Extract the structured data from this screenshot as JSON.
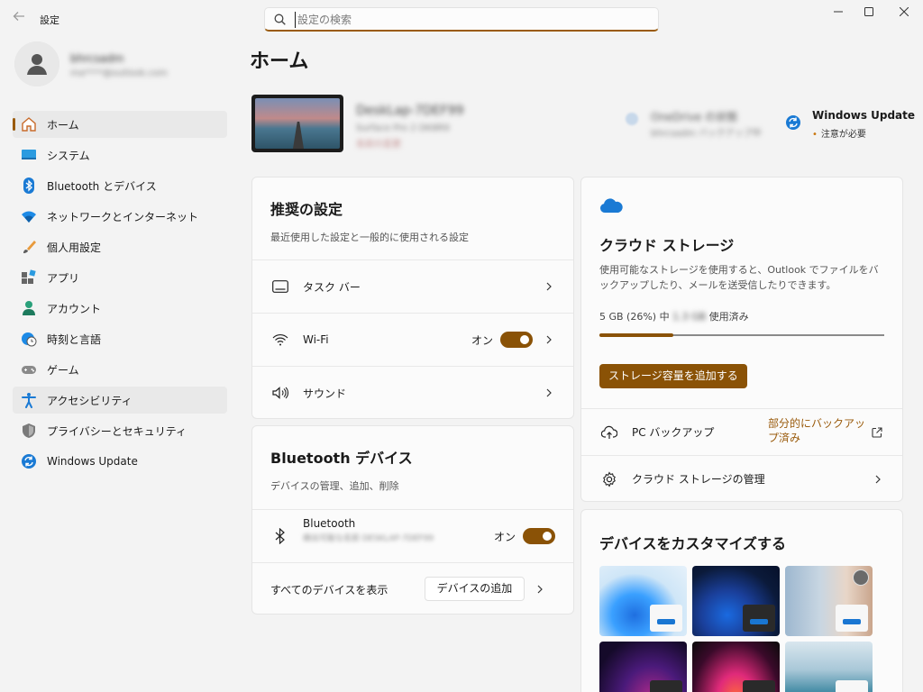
{
  "window": {
    "app_title": "設定",
    "controls": {
      "minimize": "—",
      "maximize": "☐",
      "close": "✕"
    }
  },
  "search": {
    "placeholder": "設定の検索",
    "value": ""
  },
  "profile": {
    "name": "bhrcsadm",
    "email": "ma****@outlook.com"
  },
  "sidebar": {
    "items": [
      {
        "label": "ホーム",
        "icon": "home-icon"
      },
      {
        "label": "システム",
        "icon": "system-icon"
      },
      {
        "label": "Bluetooth とデバイス",
        "icon": "bluetooth-icon"
      },
      {
        "label": "ネットワークとインターネット",
        "icon": "network-icon"
      },
      {
        "label": "個人用設定",
        "icon": "personalization-icon"
      },
      {
        "label": "アプリ",
        "icon": "apps-icon"
      },
      {
        "label": "アカウント",
        "icon": "account-icon"
      },
      {
        "label": "時刻と言語",
        "icon": "time-language-icon"
      },
      {
        "label": "ゲーム",
        "icon": "gaming-icon"
      },
      {
        "label": "アクセシビリティ",
        "icon": "accessibility-icon"
      },
      {
        "label": "プライバシーとセキュリティ",
        "icon": "privacy-icon"
      },
      {
        "label": "Windows Update",
        "icon": "windows-update-icon"
      }
    ]
  },
  "page": {
    "title": "ホーム"
  },
  "device": {
    "name": "DeskLap-7DEF99",
    "spec": "Surface Pro 2 DK8R9",
    "spec2": "名前の変更"
  },
  "onedrive_status": {
    "title": "OneDrive の状態",
    "sub": "bhrcsadm バックアップ中"
  },
  "windows_update": {
    "title": "Windows Update",
    "sub": "注意が必要"
  },
  "recommended": {
    "title": "推奨の設定",
    "desc": "最近使用した設定と一般的に使用される設定",
    "rows": [
      {
        "label": "タスク バー",
        "icon": "taskbar-icon"
      },
      {
        "label": "Wi-Fi",
        "icon": "wifi-icon",
        "toggle_label": "オン"
      },
      {
        "label": "サウンド",
        "icon": "sound-icon"
      }
    ]
  },
  "bluetooth_card": {
    "title": "Bluetooth デバイス",
    "desc": "デバイスの管理、追加、削除",
    "bt_label": "Bluetooth",
    "bt_sub": "検出可能な名前 DESKLAP-7DEF99",
    "bt_toggle_label": "オン",
    "all_devices": "すべてのデバイスを表示",
    "add_device": "デバイスの追加"
  },
  "cloud": {
    "title": "クラウド ストレージ",
    "desc": "使用可能なストレージを使用すると、Outlook でファイルをバックアップしたり、メールを送受信したりできます。",
    "usage_prefix": "5 GB (26%) 中",
    "usage_blurred": "1.3 GB",
    "usage_suffix": "使用済み",
    "usage_fraction": 0.26,
    "add_storage": "ストレージ容量を追加する",
    "backup_label": "PC バックアップ",
    "backup_status": "部分的にバックアップ済み",
    "manage_label": "クラウド ストレージの管理",
    "accent": "#8a5206"
  },
  "customize": {
    "title": "デバイスをカスタマイズする"
  }
}
